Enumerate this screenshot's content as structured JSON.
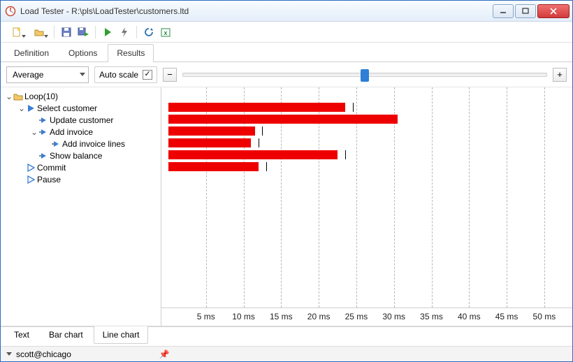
{
  "window": {
    "title": "Load Tester - R:\\pls\\LoadTester\\customers.ltd"
  },
  "tabs_top": [
    "Definition",
    "Options",
    "Results"
  ],
  "tabs_top_active": 2,
  "controls": {
    "metric_select": "Average",
    "autoscale_label": "Auto scale",
    "autoscale_checked": true,
    "zoom_minus": "−",
    "zoom_plus": "+",
    "slider_pos_pct": 50
  },
  "tree": [
    {
      "indent": 0,
      "expander": "v",
      "icon": "folder",
      "label": "Loop(10)"
    },
    {
      "indent": 1,
      "expander": "v",
      "icon": "play-blue",
      "label": "Select customer"
    },
    {
      "indent": 2,
      "expander": "",
      "icon": "play-arrow",
      "label": "Update customer"
    },
    {
      "indent": 2,
      "expander": "v",
      "icon": "play-arrow",
      "label": "Add invoice"
    },
    {
      "indent": 3,
      "expander": "",
      "icon": "play-arrow",
      "label": "Add invoice lines"
    },
    {
      "indent": 2,
      "expander": "",
      "icon": "play-arrow",
      "label": "Show balance"
    },
    {
      "indent": 1,
      "expander": "",
      "icon": "play-outline",
      "label": "Commit"
    },
    {
      "indent": 1,
      "expander": "",
      "icon": "play-outline",
      "label": "Pause"
    }
  ],
  "chart_data": {
    "type": "bar",
    "title": "",
    "xlabel": "",
    "ylabel": "",
    "x_unit": "ms",
    "x_ticks": [
      5,
      10,
      15,
      20,
      25,
      30,
      35,
      40,
      45,
      50
    ],
    "xlim": [
      0,
      51.5
    ],
    "series": [
      {
        "name": "Select customer",
        "row": 1,
        "value": 23.5,
        "whisker": 24.5
      },
      {
        "name": "Update customer",
        "row": 2,
        "value": 30.5,
        "whisker": null
      },
      {
        "name": "Add invoice",
        "row": 3,
        "value": 11.5,
        "whisker": 12.5
      },
      {
        "name": "Add invoice lines",
        "row": 4,
        "value": 11.0,
        "whisker": 12.0
      },
      {
        "name": "Show balance",
        "row": 5,
        "value": 22.5,
        "whisker": 23.5
      },
      {
        "name": "Commit",
        "row": 6,
        "value": 12.0,
        "whisker": 13.0
      }
    ]
  },
  "axis_labels": [
    "5 ms",
    "10 ms",
    "15 ms",
    "20 ms",
    "25 ms",
    "30 ms",
    "35 ms",
    "40 ms",
    "45 ms",
    "50 ms"
  ],
  "tabs_bottom": [
    "Text",
    "Bar chart",
    "Line chart"
  ],
  "tabs_bottom_active": 2,
  "status": {
    "user": "scott@chicago"
  }
}
